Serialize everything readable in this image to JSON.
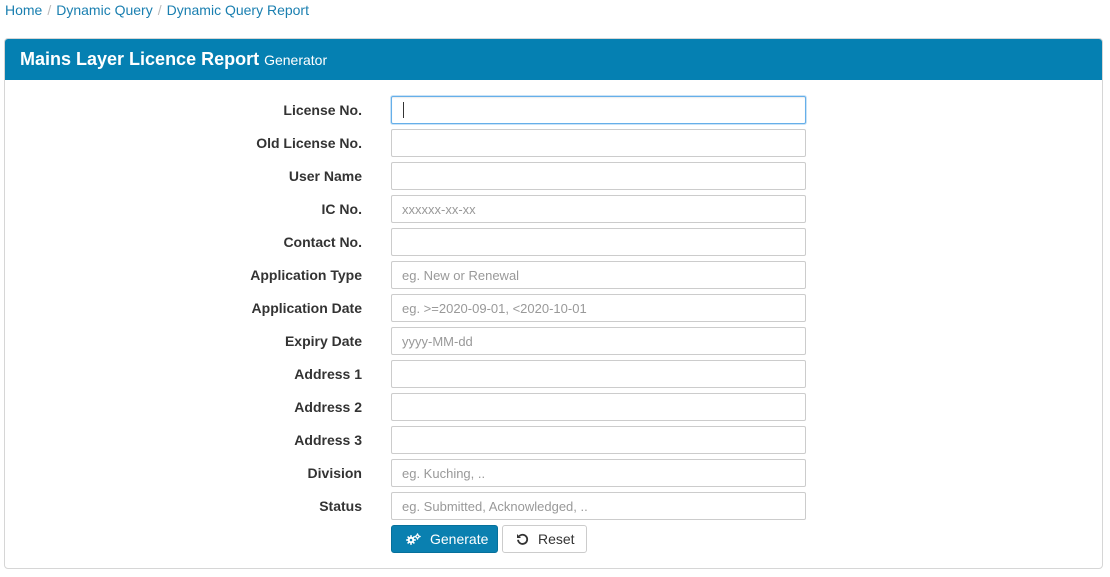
{
  "breadcrumb": {
    "home": "Home",
    "dynamic_query": "Dynamic Query",
    "report": "Dynamic Query Report"
  },
  "panel": {
    "title": "Mains Layer Licence Report",
    "subtitle": "Generator"
  },
  "form": {
    "license_no": {
      "label": "License No.",
      "value": "",
      "placeholder": ""
    },
    "old_license_no": {
      "label": "Old License No.",
      "value": "",
      "placeholder": ""
    },
    "user_name": {
      "label": "User Name",
      "value": "",
      "placeholder": ""
    },
    "ic_no": {
      "label": "IC No.",
      "value": "",
      "placeholder": "xxxxxx-xx-xx"
    },
    "contact_no": {
      "label": "Contact No.",
      "value": "",
      "placeholder": ""
    },
    "application_type": {
      "label": "Application Type",
      "value": "",
      "placeholder": "eg. New or Renewal"
    },
    "application_date": {
      "label": "Application Date",
      "value": "",
      "placeholder": "eg. >=2020-09-01, <2020-10-01"
    },
    "expiry_date": {
      "label": "Expiry Date",
      "value": "",
      "placeholder": "yyyy-MM-dd"
    },
    "address1": {
      "label": "Address 1",
      "value": "",
      "placeholder": ""
    },
    "address2": {
      "label": "Address 2",
      "value": "",
      "placeholder": ""
    },
    "address3": {
      "label": "Address 3",
      "value": "",
      "placeholder": ""
    },
    "division": {
      "label": "Division",
      "value": "",
      "placeholder": "eg. Kuching, .."
    },
    "status": {
      "label": "Status",
      "value": "",
      "placeholder": "eg. Submitted, Acknowledged, .."
    }
  },
  "buttons": {
    "generate": "Generate",
    "reset": "Reset"
  },
  "colors": {
    "header_bg": "#0580b2",
    "primary": "#0a80b0",
    "link": "#1a7fb0"
  }
}
